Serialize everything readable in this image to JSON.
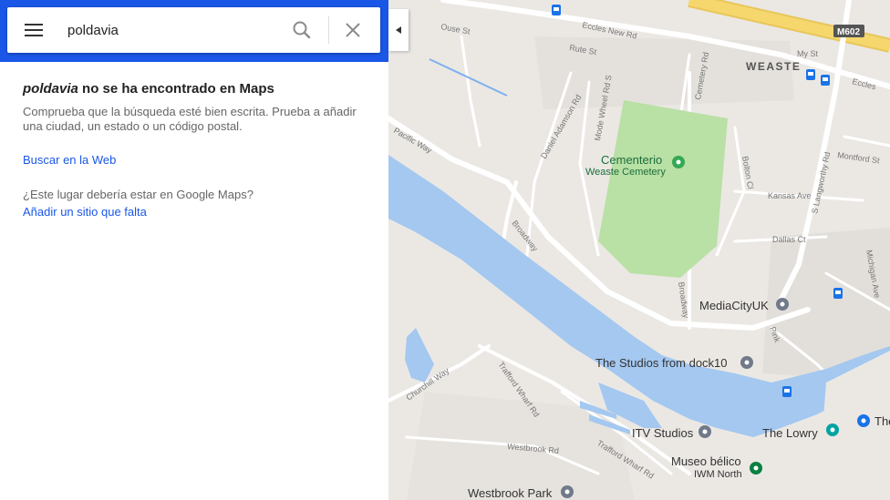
{
  "search": {
    "query": "poldavia"
  },
  "results": {
    "not_found_query": "poldavia",
    "not_found_suffix": " no se ha encontrado en Maps",
    "description": "Comprueba que la búsqueda esté bien escrita. Prueba a añadir una ciudad, un estado o un código postal.",
    "search_web_link": "Buscar en la Web",
    "missing_place_question": "¿Este lugar debería estar en Google Maps?",
    "add_missing_place_link": "Añadir un sitio que falta"
  },
  "map": {
    "areas": [
      "WEASTE"
    ],
    "shields": [
      "M602"
    ],
    "roads": [
      "Eccles New Rd",
      "Eccles",
      "Ouse St",
      "Rute St",
      "Cemetery Rd",
      "My St",
      "Daniel Adamson Rd",
      "Mode Wheel Rd S",
      "Pacific Way",
      "Broadway",
      "Bolton Cl",
      "S Langworthy Rd",
      "Montford St",
      "Kansas Ave",
      "Dallas Ct",
      "Michigan Ave",
      "Pink",
      "Churchill Way",
      "Trafford Wharf Rd",
      "Westbrook Rd",
      "Trafford Wharf Rd",
      "Broadway"
    ],
    "places": [
      {
        "name": "Cementerio",
        "subtitle": "Weaste Cemetery"
      },
      {
        "name": "MediaCityUK"
      },
      {
        "name": "The Studios from dock10"
      },
      {
        "name": "ITV Studios"
      },
      {
        "name": "The Lowry"
      },
      {
        "name": "The"
      },
      {
        "name": "Museo bélico",
        "subtitle": "IWM North"
      },
      {
        "name": "Westbrook Park"
      }
    ]
  },
  "colors": {
    "header_blue": "#1a57e6",
    "link_blue": "#1a57e6",
    "water": "#a4c8f0",
    "park": "#b9e0a5",
    "map_bg": "#ebe8e4",
    "motorway": "#f5d76e",
    "pin_gray": "#707a8a",
    "pin_green": "#34a853",
    "transit": "#1a73e8"
  },
  "icons": [
    "menu-icon",
    "search-icon",
    "close-icon",
    "collapse-arrow-icon",
    "place-pin-icon",
    "transit-station-icon"
  ]
}
